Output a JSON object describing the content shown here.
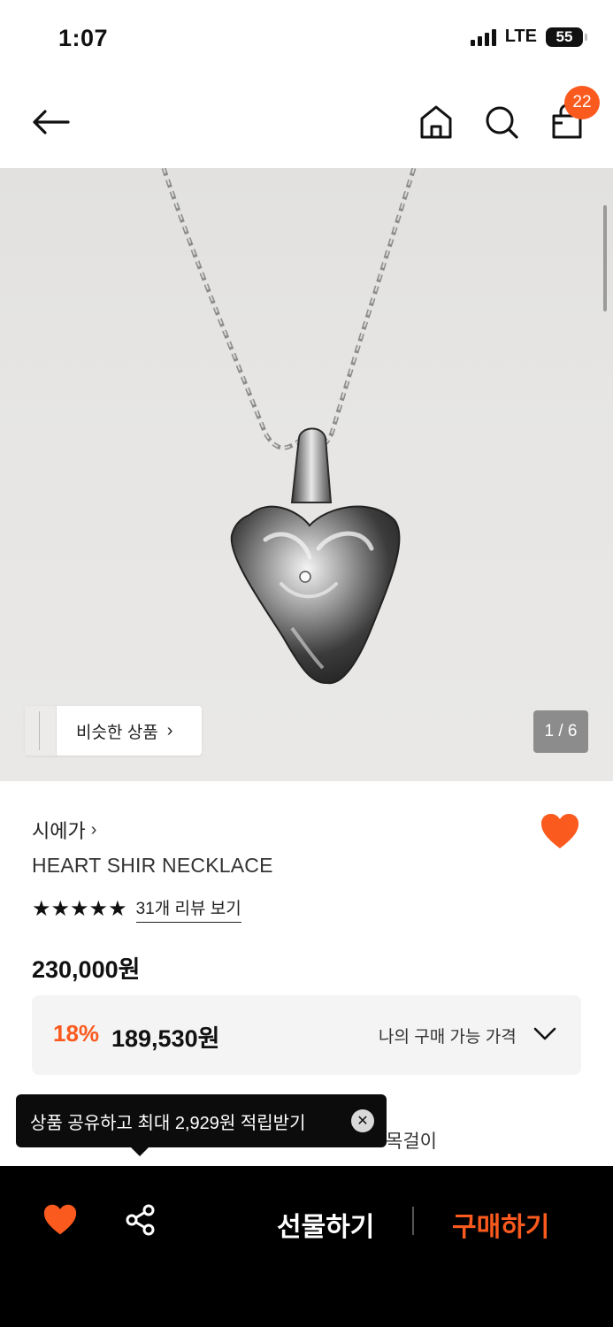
{
  "status_bar": {
    "time": "1:07",
    "network": "LTE",
    "battery": "55"
  },
  "nav": {
    "cart_count": "22"
  },
  "icons": {
    "back": "arrow-left-icon",
    "home": "home-icon",
    "search": "search-icon",
    "cart": "shopping-bag-icon",
    "like": "heart-icon",
    "share": "share-icon",
    "close": "close-icon"
  },
  "gallery": {
    "similar_label": "비슷한 상품",
    "counter": "1 / 6"
  },
  "product": {
    "brand": "시에가",
    "name": "HEART SHIR NECKLACE",
    "rating_stars": 5,
    "stars_text": "★★★★★",
    "review_link": "31개 리뷰 보기",
    "price": "230,000원",
    "discount_percent": "18%",
    "sale_price": "189,530원",
    "my_price_label": "나의 구매 가능 가격",
    "category_partial": "목걸이"
  },
  "tooltip": {
    "text": "상품 공유하고 최대 2,929원 적립받기"
  },
  "bottom_bar": {
    "gift_label": "선물하기",
    "buy_label": "구매하기"
  },
  "colors": {
    "accent": "#fa5a1e",
    "bottom_bar_bg": "#000000"
  }
}
